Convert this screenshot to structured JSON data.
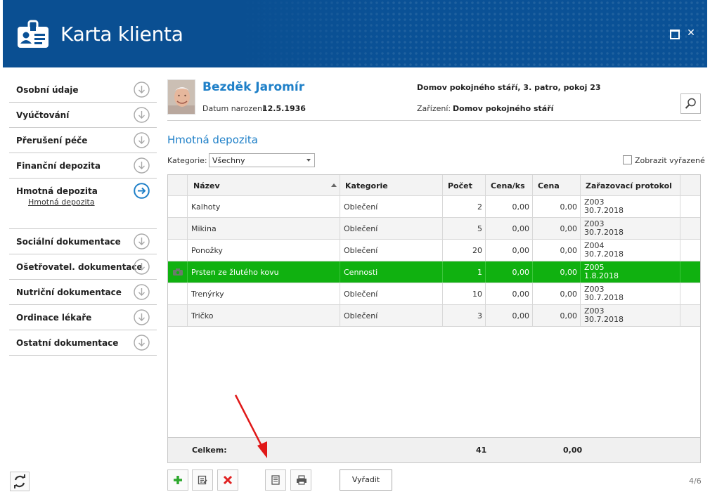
{
  "window": {
    "title": "Karta klienta"
  },
  "sidebar": {
    "items": [
      {
        "label": "Osobní údaje"
      },
      {
        "label": "Vyúčtování"
      },
      {
        "label": "Přerušení péče"
      },
      {
        "label": "Finanční depozita"
      },
      {
        "label": "Hmotná depozita"
      },
      {
        "label": "Sociální dokumentace"
      },
      {
        "label": "Ošetřovatel. dokumentace"
      },
      {
        "label": "Nutriční dokumentace"
      },
      {
        "label": "Ordinace lékaře"
      },
      {
        "label": "Ostatní dokumentace"
      }
    ],
    "sub_item": "Hmotná depozita"
  },
  "client": {
    "name": "Bezděk Jaromír",
    "dob_label": "Datum narození:",
    "dob": "12.5.1936",
    "location": "Domov pokojného stáří, 3. patro, pokoj 23",
    "facility_label": "Zařízení:",
    "facility": "Domov pokojného stáří"
  },
  "section_title": "Hmotná depozita",
  "filter": {
    "category_label": "Kategorie:",
    "category_value": "Všechny",
    "show_removed_label": "Zobrazit vyřazené"
  },
  "table": {
    "headers": {
      "name": "Název",
      "category": "Kategorie",
      "count": "Počet",
      "unit_price": "Cena/ks",
      "price": "Cena",
      "protocol": "Zařazovací protokol"
    },
    "rows": [
      {
        "name": "Kalhoty",
        "category": "Oblečení",
        "count": "2",
        "unit_price": "0,00",
        "price": "0,00",
        "protocol_no": "Z003",
        "protocol_date": "30.7.2018"
      },
      {
        "name": "Mikina",
        "category": "Oblečení",
        "count": "5",
        "unit_price": "0,00",
        "price": "0,00",
        "protocol_no": "Z003",
        "protocol_date": "30.7.2018"
      },
      {
        "name": "Ponožky",
        "category": "Oblečení",
        "count": "20",
        "unit_price": "0,00",
        "price": "0,00",
        "protocol_no": "Z004",
        "protocol_date": "30.7.2018"
      },
      {
        "name": "Prsten ze žlutého kovu",
        "category": "Cennosti",
        "count": "1",
        "unit_price": "0,00",
        "price": "0,00",
        "protocol_no": "Z005",
        "protocol_date": "1.8.2018"
      },
      {
        "name": "Trenýrky",
        "category": "Oblečení",
        "count": "10",
        "unit_price": "0,00",
        "price": "0,00",
        "protocol_no": "Z003",
        "protocol_date": "30.7.2018"
      },
      {
        "name": "Tričko",
        "category": "Oblečení",
        "count": "3",
        "unit_price": "0,00",
        "price": "0,00",
        "protocol_no": "Z003",
        "protocol_date": "30.7.2018"
      }
    ],
    "footer": {
      "label": "Celkem:",
      "count_total": "41",
      "price_total": "0,00"
    }
  },
  "toolbar": {
    "remove_label": "Vyřadit"
  },
  "pager": {
    "text": "4/6"
  },
  "colors": {
    "titlebar": "#0a5196",
    "accent": "#1f80c8",
    "selected_row": "#10b110"
  }
}
